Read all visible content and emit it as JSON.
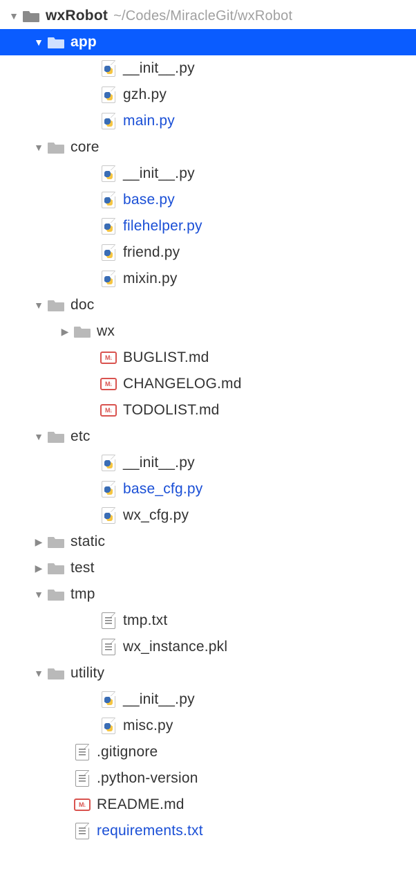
{
  "root": {
    "name": "wxRobot",
    "path": "~/Codes/MiracleGit/wxRobot"
  },
  "tree": [
    {
      "level": 1,
      "type": "folder",
      "expanded": true,
      "selected": true,
      "label": "app"
    },
    {
      "level": 3,
      "type": "py",
      "label": "__init__.py"
    },
    {
      "level": 3,
      "type": "py",
      "label": "gzh.py"
    },
    {
      "level": 3,
      "type": "py",
      "label": "main.py",
      "blue": true
    },
    {
      "level": 1,
      "type": "folder",
      "expanded": true,
      "label": "core"
    },
    {
      "level": 3,
      "type": "py",
      "label": "__init__.py"
    },
    {
      "level": 3,
      "type": "py",
      "label": "base.py",
      "blue": true
    },
    {
      "level": 3,
      "type": "py",
      "label": "filehelper.py",
      "blue": true
    },
    {
      "level": 3,
      "type": "py",
      "label": "friend.py"
    },
    {
      "level": 3,
      "type": "py",
      "label": "mixin.py"
    },
    {
      "level": 1,
      "type": "folder",
      "expanded": true,
      "label": "doc"
    },
    {
      "level": 2,
      "type": "folder",
      "expanded": false,
      "label": "wx"
    },
    {
      "level": 3,
      "type": "md",
      "label": "BUGLIST.md"
    },
    {
      "level": 3,
      "type": "md",
      "label": "CHANGELOG.md"
    },
    {
      "level": 3,
      "type": "md",
      "label": "TODOLIST.md"
    },
    {
      "level": 1,
      "type": "folder",
      "expanded": true,
      "label": "etc"
    },
    {
      "level": 3,
      "type": "py",
      "label": "__init__.py"
    },
    {
      "level": 3,
      "type": "py",
      "label": "base_cfg.py",
      "blue": true
    },
    {
      "level": 3,
      "type": "py",
      "label": "wx_cfg.py"
    },
    {
      "level": 1,
      "type": "folder",
      "expanded": false,
      "label": "static"
    },
    {
      "level": 1,
      "type": "folder",
      "expanded": false,
      "label": "test"
    },
    {
      "level": 1,
      "type": "folder",
      "expanded": true,
      "label": "tmp"
    },
    {
      "level": 3,
      "type": "txt",
      "label": "tmp.txt"
    },
    {
      "level": 3,
      "type": "txt",
      "label": "wx_instance.pkl"
    },
    {
      "level": 1,
      "type": "folder",
      "expanded": true,
      "label": "utility"
    },
    {
      "level": 3,
      "type": "py",
      "label": "__init__.py"
    },
    {
      "level": 3,
      "type": "py",
      "label": "misc.py"
    },
    {
      "level": 2,
      "type": "txt",
      "label": ".gitignore"
    },
    {
      "level": 2,
      "type": "txt",
      "label": ".python-version"
    },
    {
      "level": 2,
      "type": "md",
      "label": "README.md"
    },
    {
      "level": 2,
      "type": "txt",
      "label": "requirements.txt",
      "blue": true
    }
  ]
}
